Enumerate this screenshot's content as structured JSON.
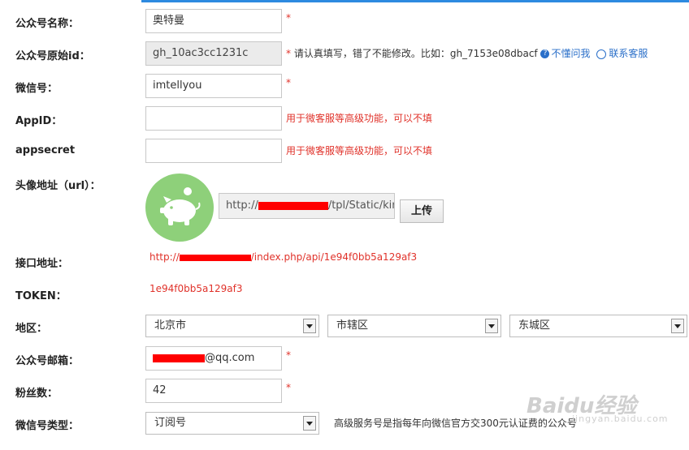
{
  "form": {
    "name": {
      "label": "公众号名称：",
      "value": "奥特曼",
      "star": "*"
    },
    "original_id": {
      "label": "公众号原始id：",
      "value": "gh_10ac3cc1231c",
      "star": "*",
      "hint": "请认真填写，错了不能修改。比如：gh_7153e08dbacf",
      "help_link": "不懂问我",
      "service_link": "联系客服"
    },
    "wechat": {
      "label": "微信号：",
      "value": "imtellyou",
      "star": "*"
    },
    "appid": {
      "label": "AppID：",
      "value": "",
      "hint": "用于微客服等高级功能，可以不填"
    },
    "appsecret": {
      "label": "appsecret",
      "value": "",
      "hint": "用于微客服等高级功能，可以不填"
    },
    "avatar": {
      "label": "头像地址（url）：",
      "url_prefix": "http://",
      "url_suffix": "/tpl/Static/kinc",
      "upload_label": "上传"
    },
    "api": {
      "label": "接口地址：",
      "prefix": "http://",
      "suffix": "/index.php/api/1e94f0bb5a129af3"
    },
    "token": {
      "label": "TOKEN：",
      "value": "1e94f0bb5a129af3"
    },
    "region": {
      "label": "地区：",
      "province": "北京市",
      "city": "市辖区",
      "district": "东城区"
    },
    "email": {
      "label": "公众号邮箱：",
      "suffix": "@qq.com",
      "star": "*"
    },
    "fans": {
      "label": "粉丝数：",
      "value": "42",
      "star": "*"
    },
    "type": {
      "label": "微信号类型：",
      "value": "订阅号",
      "hint": "高级服务号是指每年向微信官方交300元认证费的公众号"
    }
  },
  "watermark": {
    "text": "Baidu经验",
    "sub": "jingyan.baidu.com"
  },
  "colors": {
    "required": "#e0322a",
    "link": "#2a6fc9",
    "avatar_bg": "#8ed07a",
    "accent": "#2d8ae0"
  }
}
